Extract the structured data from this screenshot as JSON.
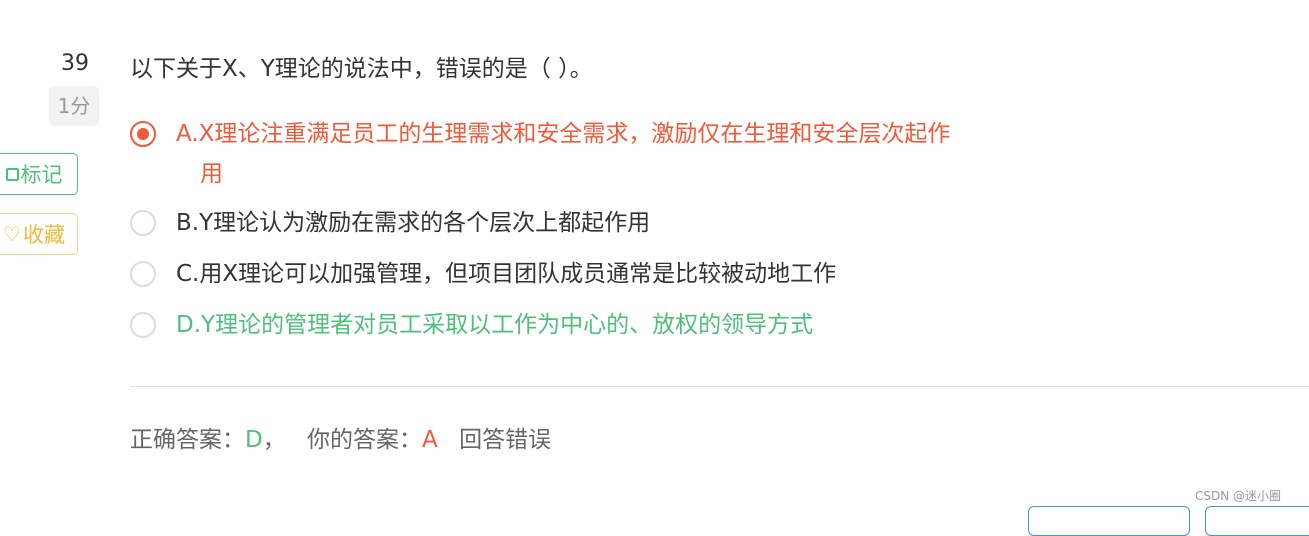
{
  "question": {
    "number": "39",
    "score": "1分",
    "text": "以下关于X、Y理论的说法中，错误的是（ ）。"
  },
  "side_buttons": {
    "mark_label": "标记",
    "favorite_label": "收藏"
  },
  "options": [
    {
      "line1": "A.X理论注重满足员工的生理需求和安全需求，激励仅在生理和安全层次起作",
      "line2": "用",
      "state": "selected-wrong"
    },
    {
      "line1": "B.Y理论认为激励在需求的各个层次上都起作用",
      "state": "normal"
    },
    {
      "line1": "C.用X理论可以加强管理，但项目团队成员通常是比较被动地工作",
      "state": "normal"
    },
    {
      "line1": "D.Y理论的管理者对员工采取以工作为中心的、放权的领导方式",
      "state": "correct"
    }
  ],
  "result": {
    "correct_label": "正确答案：",
    "correct_value": "D",
    "separator": "，",
    "your_label": "你的答案：",
    "your_value": "A",
    "verdict": "回答错误"
  },
  "watermark": "CSDN @迷小圈",
  "colors": {
    "wrong": "#f05a3a",
    "correct": "#4ec07a",
    "favorite": "#f0b83a",
    "bottom_button_border": "#4a90e2"
  },
  "icons": {
    "mark": "checkbox-icon",
    "favorite": "heart-icon"
  }
}
